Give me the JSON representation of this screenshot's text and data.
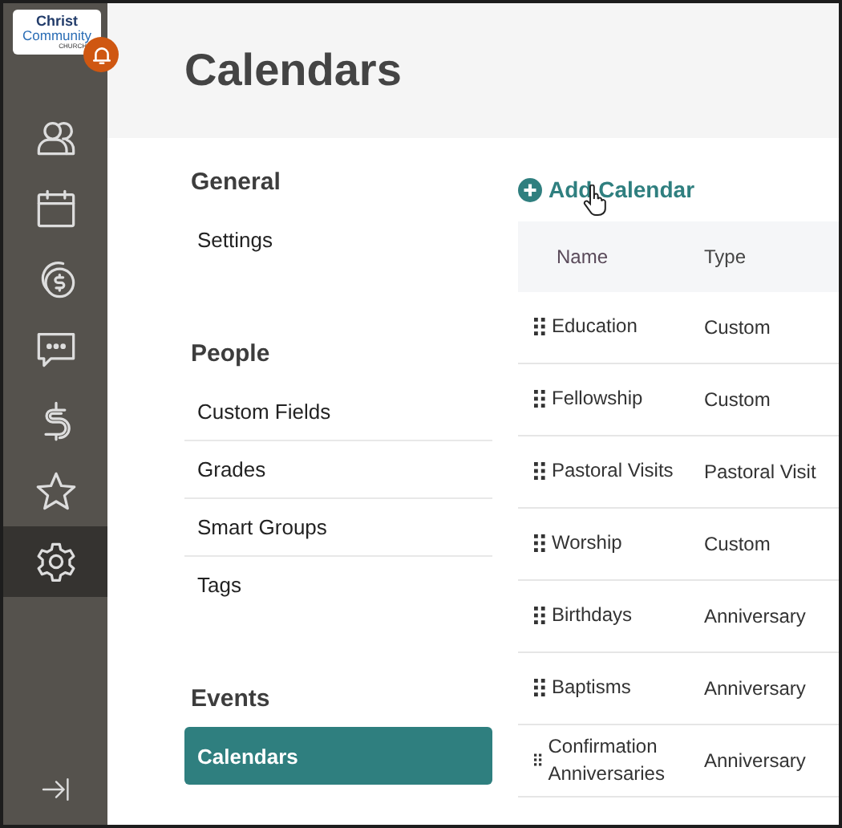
{
  "logo": {
    "line_1": "Christ",
    "line_2": "Community",
    "line_3": "CHURCH"
  },
  "sidebar": {
    "items": [
      {
        "kind": "people",
        "selected": false
      },
      {
        "kind": "calendar",
        "selected": false
      },
      {
        "kind": "coins",
        "selected": false
      },
      {
        "kind": "chat",
        "selected": false
      },
      {
        "kind": "dollar",
        "selected": false
      },
      {
        "kind": "star",
        "selected": false
      },
      {
        "kind": "gear",
        "selected": true
      }
    ]
  },
  "page": {
    "title": "Calendars"
  },
  "settings_nav": {
    "sections": [
      {
        "heading": "General",
        "items": [
          {
            "label": "Settings",
            "selected": false
          }
        ]
      },
      {
        "heading": "People",
        "items": [
          {
            "label": "Custom Fields",
            "selected": false
          },
          {
            "label": "Grades",
            "selected": false
          },
          {
            "label": "Smart Groups",
            "selected": false
          },
          {
            "label": "Tags",
            "selected": false
          }
        ]
      },
      {
        "heading": "Events",
        "items": [
          {
            "label": "Calendars",
            "selected": true
          }
        ]
      }
    ]
  },
  "add_button": {
    "label": "Add Calendar"
  },
  "table": {
    "columns": [
      "Name",
      "Type"
    ],
    "rows": [
      {
        "name": "Education",
        "type": "Custom"
      },
      {
        "name": "Fellowship",
        "type": "Custom"
      },
      {
        "name": "Pastoral Visits",
        "type": "Pastoral Visit"
      },
      {
        "name": "Worship",
        "type": "Custom"
      },
      {
        "name": "Birthdays",
        "type": "Anniversary"
      },
      {
        "name": "Baptisms",
        "type": "Anniversary"
      },
      {
        "name": "Confirmation Anniversaries",
        "type": "Anniversary"
      }
    ]
  }
}
